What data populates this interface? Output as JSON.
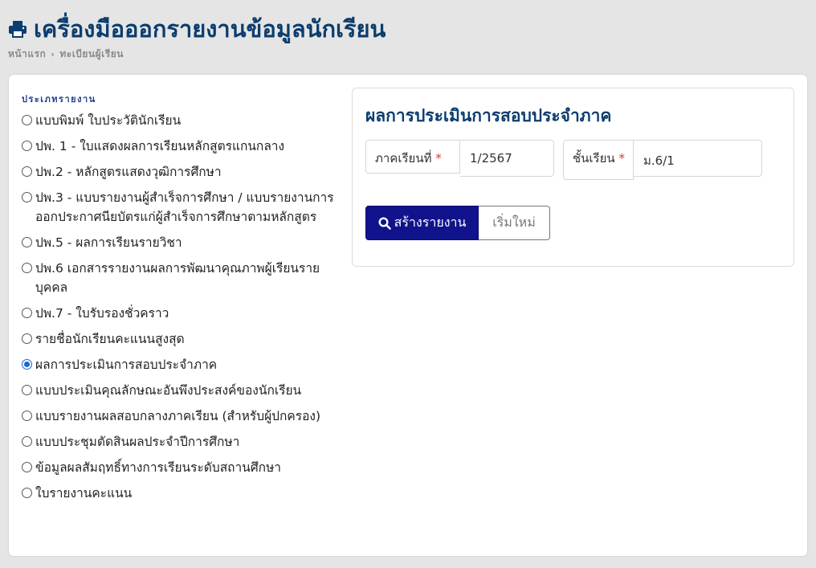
{
  "header": {
    "title": "เครื่องมือออกรายงานข้อมูลนักเรียน",
    "icon": "print-icon",
    "breadcrumb": [
      "หน้าแรก",
      "ทะเบียนผู้เรียน"
    ]
  },
  "report_types": {
    "label": "ประเภทรายงาน",
    "options": [
      {
        "label": "แบบพิมพ์ ใบประวัตินักเรียน",
        "checked": false
      },
      {
        "label": "ปพ. 1 - ใบแสดงผลการเรียนหลักสูตรแกนกลาง",
        "checked": false
      },
      {
        "label": "ปพ.2 - หลักสูตรแสดงวุฒิการศึกษา",
        "checked": false
      },
      {
        "label": "ปพ.3 - แบบรายงานผู้สำเร็จการศึกษา / แบบรายงานการออกประกาศนียบัตรแก่ผู้สำเร็จการศึกษาตามหลักสูตร",
        "checked": false
      },
      {
        "label": "ปพ.5 - ผลการเรียนรายวิชา",
        "checked": false
      },
      {
        "label": "ปพ.6 เอกสารรายงานผลการพัฒนาคุณภาพผู้เรียนรายบุคคล",
        "checked": false
      },
      {
        "label": "ปพ.7 - ใบรับรองชั่วคราว",
        "checked": false
      },
      {
        "label": "รายชื่อนักเรียนคะแนนสูงสุด",
        "checked": false
      },
      {
        "label": "ผลการประเมินการสอบประจำภาค",
        "checked": true
      },
      {
        "label": "แบบประเมินคุณลักษณะอันพึงประสงค์ของนักเรียน",
        "checked": false
      },
      {
        "label": "แบบรายงานผลสอบกลางภาคเรียน (สำหรับผู้ปกครอง)",
        "checked": false
      },
      {
        "label": "แบบประชุมตัดสินผลประจำปีการศึกษา",
        "checked": false
      },
      {
        "label": "ข้อมูลผลสัมฤทธิ์ทางการเรียนระดับสถานศึกษา",
        "checked": false
      },
      {
        "label": "ใบรายงานคะแนน",
        "checked": false
      }
    ]
  },
  "form": {
    "title": "ผลการประเมินการสอบประจำภาค",
    "semester_label": "ภาคเรียนที่",
    "semester_value": "1/2567",
    "class_label": "ชั้นเรียน",
    "class_value": "ม.6/1",
    "required_mark": "*",
    "create_button": "สร้างรายงาน",
    "reset_button": "เริ่มใหม่"
  },
  "colors": {
    "title": "#0b3d6e",
    "primary_button": "#10138c",
    "required": "#dd3333",
    "radio_checked": "#1a66d2"
  }
}
